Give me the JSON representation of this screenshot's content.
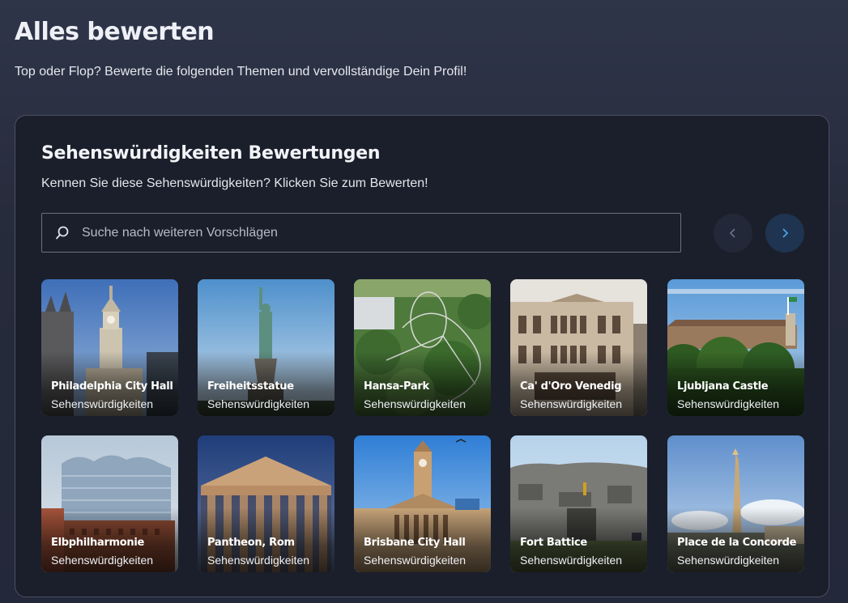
{
  "header": {
    "title": "Alles bewerten",
    "subtitle": "Top oder Flop? Bewerte die folgenden Themen und vervollständige Dein Profil!"
  },
  "panel": {
    "title": "Sehenswürdigkeiten Bewertungen",
    "subtitle": "Kennen Sie diese Sehenswürdigkeiten? Klicken Sie zum Bewerten!",
    "search_placeholder": "Suche nach weiteren Vorschlägen"
  },
  "cards": [
    {
      "name": "Philadelphia City Hall",
      "category": "Sehenswürdigkeiten"
    },
    {
      "name": "Freiheitsstatue",
      "category": "Sehenswürdigkeiten"
    },
    {
      "name": "Hansa-Park",
      "category": "Sehenswürdigkeiten"
    },
    {
      "name": "Ca' d'Oro Venedig",
      "category": "Sehenswürdigkeiten"
    },
    {
      "name": "Ljubljana Castle",
      "category": "Sehenswürdigkeiten"
    },
    {
      "name": "Elbphilharmonie",
      "category": "Sehenswürdigkeiten"
    },
    {
      "name": "Pantheon, Rom",
      "category": "Sehenswürdigkeiten"
    },
    {
      "name": "Brisbane City Hall",
      "category": "Sehenswürdigkeiten"
    },
    {
      "name": "Fort Battice",
      "category": "Sehenswürdigkeiten"
    },
    {
      "name": "Place de la Concorde",
      "category": "Sehenswürdigkeiten"
    }
  ],
  "icons": {
    "search": "search-icon",
    "prev": "chevron-left-icon",
    "next": "chevron-right-icon"
  },
  "colors": {
    "accent": "#4aa3e8",
    "panel_bg": "#1b1f2b"
  }
}
